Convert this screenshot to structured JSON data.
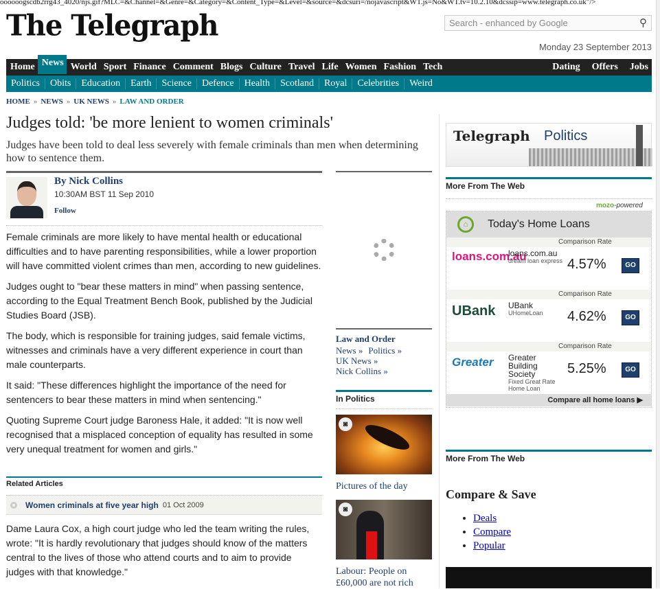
{
  "junk_text": "oooooogscdb2rrg43_4020/njs.gif?MLC=&Channel=&Genre=&Category=&Content_Type=&Level=&source=&dcsuri=/nojavascript&WT.js=No&WT.tv=10.2.10&dcssip=www.telegraph.co.uk\"/>",
  "header": {
    "logo": "The Telegraph",
    "search_placeholder": "Search - enhanced by Google",
    "date": "Monday 23 September 2013"
  },
  "nav": {
    "left": [
      "Home",
      "News",
      "World",
      "Sport",
      "Finance",
      "Comment",
      "Blogs",
      "Culture",
      "Travel",
      "Life",
      "Women",
      "Fashion",
      "Tech"
    ],
    "active": "News",
    "right": [
      "Dating",
      "Offers",
      "Jobs"
    ]
  },
  "subnav": [
    "Politics",
    "Obits",
    "Education",
    "Earth",
    "Science",
    "Defence",
    "Health",
    "Scotland",
    "Royal",
    "Celebrities",
    "Weird"
  ],
  "breadcrumb": [
    "HOME",
    "NEWS",
    "UK NEWS",
    "LAW AND ORDER"
  ],
  "breadcrumb_sep": "»",
  "article": {
    "headline": "Judges told: 'be more lenient to women criminals'",
    "standfirst": "Judges have been told to deal less severely with female criminals than men when determining how to sentence them.",
    "author": "By Nick Collins",
    "time": "10:30AM BST 11 Sep 2010",
    "follow": "Follow",
    "paragraphs": [
      "Female criminals are more likely to have mental health or educational difficulties and to have parenting responsibilities, while a lower proportion will have committed violent crimes than men, according to new guidelines.",
      "Judges ought to \"bear these matters in mind\" when passing sentence, according to the Equal Treatment Bench Book, published by the Judicial Studies Board (JSB).",
      "The body, which is responsible for training judges, said female victims, witnesses and criminals have a very different experience in court than male counterparts.",
      "It said: \"These differences highlight the importance of the need for sentencers to bear these matters in mind when sentencing.\"",
      "Quoting Supreme Court judge Baroness Hale, it added: \"It is now well recognised that a misplaced conception of equality has resulted in some very unequal treatment for women and girls.\""
    ],
    "related_title": "Related Articles",
    "related": {
      "title": "Women criminals at five year high",
      "date": "01 Oct 2009"
    },
    "after_related": "Dame Laura Cox, a high court judge who led the team writing the rules, wrote: \"It is hardly revolutionary that judges should know of the matters central to the lives of those who attend courts and to aim to provide judges with that knowledge.\""
  },
  "mid": {
    "law_title": "Law and Order",
    "links": [
      "News »",
      "Politics »",
      "UK News »",
      "Nick Collins »"
    ],
    "in_politics": "In Politics",
    "pic1_caption": "Pictures of the day",
    "pic2_caption": "Labour: People on £60,000 are not rich"
  },
  "right": {
    "banner_a": "Telegraph",
    "banner_b": "Politics",
    "more_web": "More From The Web",
    "mozo_a": "mozo",
    "mozo_b": "-powered",
    "loans_title": "Today's Home Loans",
    "comparison_label": "Comparison Rate",
    "loans": [
      {
        "logo": "loans.com.au",
        "name": "loans.com.au",
        "product": "dream loan express",
        "rate": "4.57%",
        "go": "GO"
      },
      {
        "logo": "UBank",
        "name": "UBank",
        "product": "UHomeLoan",
        "rate": "4.62%",
        "go": "GO"
      },
      {
        "logo": "Greater",
        "name": "Greater Building Society",
        "product": "Fixed Great Rate Home Loan",
        "rate": "5.25%",
        "go": "GO"
      }
    ],
    "compare_all": "Compare all home loans ▶",
    "more_web_2": "More From The Web",
    "compare_save": "Compare & Save",
    "compare_links": [
      "Deals",
      "Compare",
      "Popular"
    ]
  },
  "colors": {
    "teal": "#007a8a",
    "dark": "#222222",
    "link": "#1f3f6e"
  }
}
